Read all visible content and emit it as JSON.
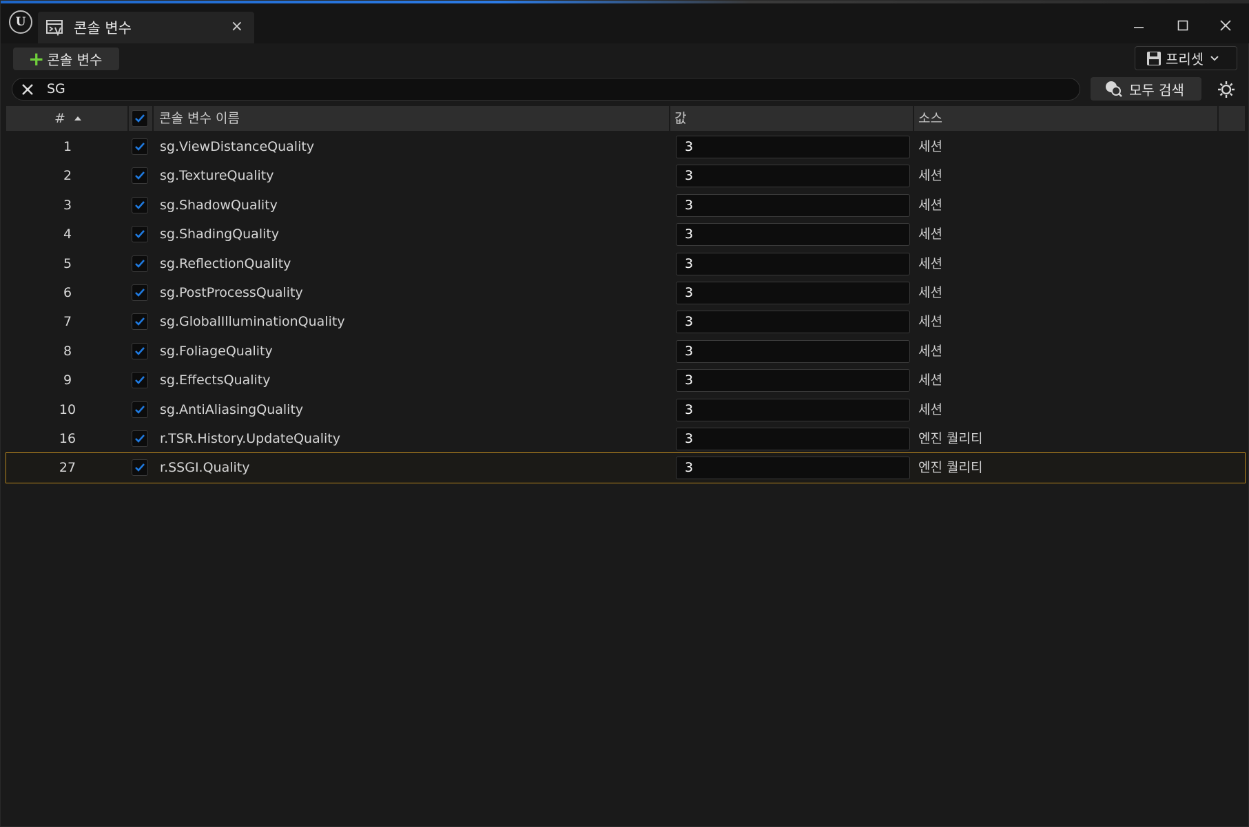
{
  "window": {
    "tab_title": "콘솔 변수",
    "tab_close": "×"
  },
  "toolbar": {
    "add_label": "콘솔 변수",
    "preset_label": "프리셋"
  },
  "search": {
    "value": "SG",
    "search_all_label": "모두 검색"
  },
  "table": {
    "headers": {
      "num": "#",
      "name": "콘솔 변수 이름",
      "value": "값",
      "source": "소스"
    },
    "rows": [
      {
        "num": "1",
        "name": "sg.ViewDistanceQuality",
        "value": "3",
        "source": "세션"
      },
      {
        "num": "2",
        "name": "sg.TextureQuality",
        "value": "3",
        "source": "세션"
      },
      {
        "num": "3",
        "name": "sg.ShadowQuality",
        "value": "3",
        "source": "세션"
      },
      {
        "num": "4",
        "name": "sg.ShadingQuality",
        "value": "3",
        "source": "세션"
      },
      {
        "num": "5",
        "name": "sg.ReflectionQuality",
        "value": "3",
        "source": "세션"
      },
      {
        "num": "6",
        "name": "sg.PostProcessQuality",
        "value": "3",
        "source": "세션"
      },
      {
        "num": "7",
        "name": "sg.GlobalIlluminationQuality",
        "value": "3",
        "source": "세션"
      },
      {
        "num": "8",
        "name": "sg.FoliageQuality",
        "value": "3",
        "source": "세션"
      },
      {
        "num": "9",
        "name": "sg.EffectsQuality",
        "value": "3",
        "source": "세션"
      },
      {
        "num": "10",
        "name": "sg.AntiAliasingQuality",
        "value": "3",
        "source": "세션"
      },
      {
        "num": "16",
        "name": "r.TSR.History.UpdateQuality",
        "value": "3",
        "source": "엔진 퀄리티"
      },
      {
        "num": "27",
        "name": "r.SSGI.Quality",
        "value": "3",
        "source": "엔진 퀄리티"
      }
    ]
  },
  "colors": {
    "accent": "#1f7ae0",
    "plus": "#6fcf3b",
    "selection": "#b8871e"
  }
}
